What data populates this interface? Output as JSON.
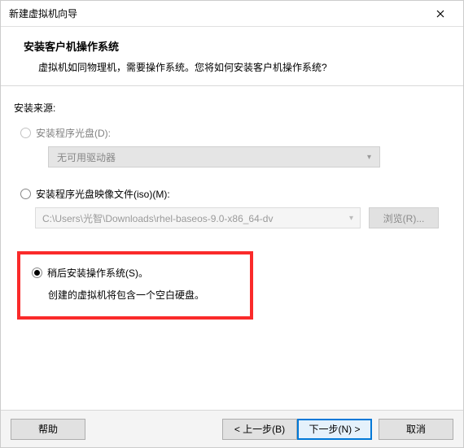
{
  "window": {
    "title": "新建虚拟机向导"
  },
  "header": {
    "heading": "安装客户机操作系统",
    "sub": "虚拟机如同物理机，需要操作系统。您将如何安装客户机操作系统?"
  },
  "source": {
    "section_label": "安装来源:",
    "disc": {
      "label": "安装程序光盘(D):"
    },
    "drive_selected": "无可用驱动器",
    "iso": {
      "label": "安装程序光盘映像文件(iso)(M):"
    },
    "iso_path": "C:\\Users\\光智\\Downloads\\rhel-baseos-9.0-x86_64-dv",
    "browse": "浏览(R)...",
    "later": {
      "label": "稍后安装操作系统(S)。"
    },
    "later_desc": "创建的虚拟机将包含一个空白硬盘。"
  },
  "footer": {
    "help": "帮助",
    "back": "< 上一步(B)",
    "next": "下一步(N) >",
    "cancel": "取消"
  }
}
